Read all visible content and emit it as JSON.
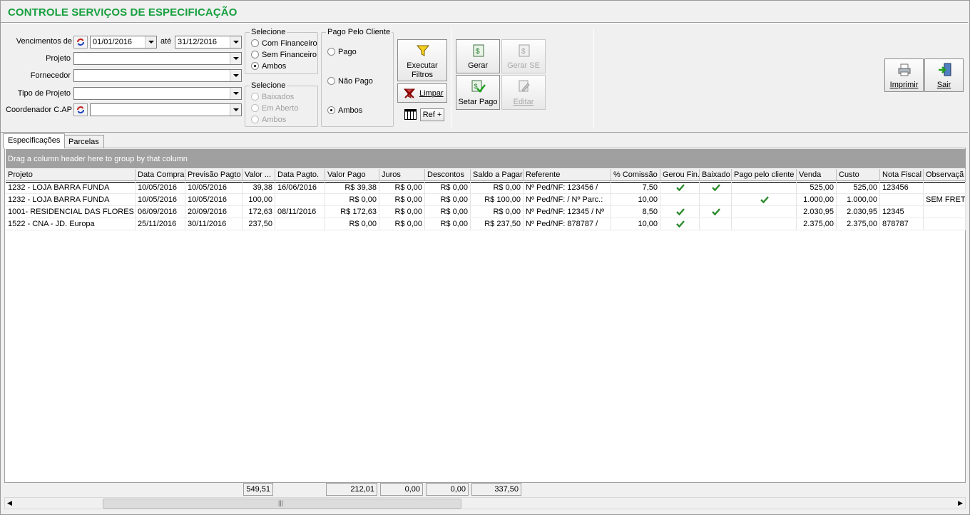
{
  "window": {
    "title": "CONTROLE SERVIÇOS DE ESPECIFICAÇÃO"
  },
  "filters": {
    "vencimentos_label": "Vencimentos de",
    "date_from": "01/01/2016",
    "ate_label": "até",
    "date_to": "31/12/2016",
    "projeto_label": "Projeto",
    "projeto_value": "",
    "fornecedor_label": "Fornecedor",
    "fornecedor_value": "",
    "tipo_projeto_label": "Tipo de Projeto",
    "tipo_projeto_value": "",
    "coordenador_label": "Coordenador C.AP",
    "coordenador_value": ""
  },
  "group_financeiro": {
    "title": "Selecione",
    "options": [
      "Com Financeiro",
      "Sem Financeiro",
      "Ambos"
    ],
    "selected": "Ambos"
  },
  "group_baixa": {
    "title": "Selecione",
    "options": [
      "Baixados",
      "Em Aberto",
      "Ambos"
    ]
  },
  "group_pago": {
    "title": "Pago Pelo Cliente",
    "options": [
      "Pago",
      "Não Pago",
      "Ambos"
    ],
    "selected": "Ambos"
  },
  "buttons": {
    "executar": "Executar\nFiltros",
    "executar_l1": "Executar",
    "executar_l2": "Filtros",
    "limpar": "Limpar",
    "ref": "Ref +",
    "gerar": "Gerar",
    "gerar_se": "Gerar SE",
    "setar_pago": "Setar Pago",
    "editar": "Editar",
    "imprimir": "Imprimir",
    "sair": "Sair"
  },
  "tabs": [
    "Especificações",
    "Parcelas"
  ],
  "grid": {
    "group_hint": "Drag a column header here to group by that column",
    "columns": [
      "Projeto",
      "Data Compra",
      "Previsão Pagto",
      "Valor ...",
      "Data Pagto.",
      "Valor Pago",
      "Juros",
      "Descontos",
      "Saldo a Pagar",
      "Referente",
      "% Comissão",
      "Gerou Fin.",
      "Baixado",
      "Pago pelo cliente",
      "Venda",
      "Custo",
      "Nota Fiscal",
      "Observaçã"
    ],
    "rows": [
      {
        "projeto": "1232 - LOJA BARRA FUNDA",
        "data_compra": "10/05/2016",
        "previsao": "10/05/2016",
        "valor": "39,38",
        "data_pagto": "16/06/2016",
        "valor_pago": "R$ 39,38",
        "juros": "R$ 0,00",
        "descontos": "R$ 0,00",
        "saldo": "R$ 0,00",
        "referente": "Nº Ped/NF: 123456  /",
        "comissao": "7,50",
        "gerou": true,
        "baixado": true,
        "pago_cliente": false,
        "venda": "525,00",
        "custo": "525,00",
        "nota": "123456",
        "obs": ""
      },
      {
        "projeto": "1232 - LOJA BARRA FUNDA",
        "data_compra": "10/05/2016",
        "previsao": "10/05/2016",
        "valor": "100,00",
        "data_pagto": "",
        "valor_pago": "R$ 0,00",
        "juros": "R$ 0,00",
        "descontos": "R$ 0,00",
        "saldo": "R$ 100,00",
        "referente": "Nº Ped/NF:   /  Nº Parc.:",
        "comissao": "10,00",
        "gerou": false,
        "baixado": false,
        "pago_cliente": true,
        "venda": "1.000,00",
        "custo": "1.000,00",
        "nota": "",
        "obs": "SEM FRETI"
      },
      {
        "projeto": "1001- RESIDENCIAL DAS FLORES",
        "data_compra": "06/09/2016",
        "previsao": "20/09/2016",
        "valor": "172,63",
        "data_pagto": "08/11/2016",
        "valor_pago": "R$ 172,63",
        "juros": "R$ 0,00",
        "descontos": "R$ 0,00",
        "saldo": "R$ 0,00",
        "referente": "Nº Ped/NF: 12345  /  Nº",
        "comissao": "8,50",
        "gerou": true,
        "baixado": true,
        "pago_cliente": false,
        "venda": "2.030,95",
        "custo": "2.030,95",
        "nota": "12345",
        "obs": ""
      },
      {
        "projeto": "1522 - CNA - JD. Europa",
        "data_compra": "25/11/2016",
        "previsao": "30/11/2016",
        "valor": "237,50",
        "data_pagto": "",
        "valor_pago": "R$ 0,00",
        "juros": "R$ 0,00",
        "descontos": "R$ 0,00",
        "saldo": "R$ 237,50",
        "referente": "Nº Ped/NF: 878787  /",
        "comissao": "10,00",
        "gerou": true,
        "baixado": false,
        "pago_cliente": false,
        "venda": "2.375,00",
        "custo": "2.375,00",
        "nota": "878787",
        "obs": ""
      }
    ],
    "footer": {
      "valor": "549,51",
      "valor_pago": "212,01",
      "juros": "0,00",
      "descontos": "0,00",
      "saldo": "337,50"
    }
  },
  "colors": {
    "title": "#18a040",
    "check": "#2a8a2a",
    "group_bar": "#a0a0a0"
  }
}
